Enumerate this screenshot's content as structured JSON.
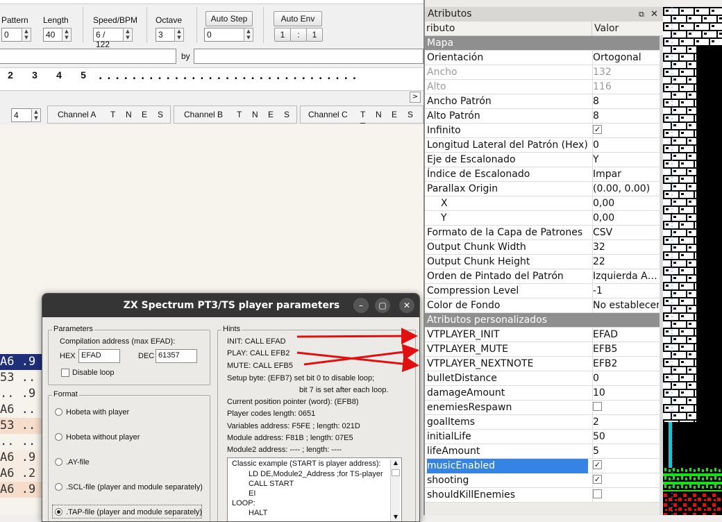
{
  "tracker": {
    "pattern_label": "Pattern",
    "pattern_value": "0",
    "length_label": "Length",
    "length_value": "40",
    "speed_label": "Speed/BPM",
    "speed_value": "6 / 122",
    "octave_label": "Octave",
    "octave_value": "3",
    "autostep_label": "Auto Step",
    "autostep_value": "0",
    "autoenv_label": "Auto Env",
    "autoenv_a": "1",
    "autoenv_sep": ":",
    "autoenv_b": "1",
    "by_label": "by",
    "positions": [
      "2",
      "3",
      "4",
      "5"
    ],
    "positions_rest": ". . . . . . . . . . . . . . . . . . . . . . . . . . . . . . .",
    "scroll_right": ">",
    "channel_spin_value": "4",
    "channels": [
      {
        "name": "Channel A",
        "flags": [
          "T",
          "N",
          "E",
          "S"
        ]
      },
      {
        "name": "Channel B",
        "flags": [
          "T",
          "N",
          "E",
          "S"
        ]
      },
      {
        "name": "Channel C",
        "flags": [
          "T",
          "N",
          "E",
          "S"
        ]
      }
    ],
    "rows": [
      {
        "a": "A6",
        "b": ".9"
      },
      {
        "a": "53",
        "b": ".."
      },
      {
        "a": "..",
        "b": ".9"
      },
      {
        "a": "A6",
        "b": ".."
      },
      {
        "a": "53",
        "b": ".."
      },
      {
        "a": "..",
        "b": ".."
      },
      {
        "a": "A6",
        "b": ".9"
      },
      {
        "a": "A6",
        "b": ".2"
      },
      {
        "a": "A6",
        "b": ".9"
      }
    ]
  },
  "dialog": {
    "title": "ZX Spectrum PT3/TS player parameters",
    "parameters_label": "Parameters",
    "compilation_label": "Compilation address (max    EFAD):",
    "hex_label": "HEX",
    "hex_value": "EFAD",
    "dec_label": "DEC",
    "dec_value": "61357",
    "disable_loop": "Disable loop",
    "format_label": "Format",
    "formats": [
      "Hobeta with player",
      "Hobeta without player",
      ".AY-file",
      ".SCL-file (player and module separately)",
      ".TAP-file (player and module separately)"
    ],
    "hints_label": "Hints",
    "hints": [
      "INIT: CALL  EFAD",
      "PLAY: CALL   EFB2",
      "MUTE: CALL    EFB5",
      "Setup byte:  (EFB7)   set bit 0 to disable loop;",
      "bit 7 is set after each loop.",
      "Current position pointer (word):   (EFB8)",
      "Player codes length:     0651",
      "Variables address:  F5FE  ; length:  021D",
      "Module address:     F81B  ; length:  07E5",
      "Module2 address:    ----      ; length:  ----"
    ],
    "code": [
      "Classic example (START is player address):",
      "LD DE,Module2_Address ;for TS-player",
      "CALL START",
      "EI",
      "LOOP:",
      "HALT"
    ]
  },
  "props": {
    "title": "Atributos",
    "col_name": "ributo",
    "col_value": "Valor",
    "rows": [
      {
        "k": "Mapa",
        "v": "",
        "type": "group"
      },
      {
        "k": "Orientación",
        "v": "Ortogonal"
      },
      {
        "k": "Ancho",
        "v": "132",
        "type": "dis"
      },
      {
        "k": "Alto",
        "v": "116",
        "type": "dis"
      },
      {
        "k": "Ancho Patrón",
        "v": "8"
      },
      {
        "k": "Alto Patrón",
        "v": "8"
      },
      {
        "k": "Infinito",
        "v": "",
        "check": true
      },
      {
        "k": "Longitud Lateral del Patrón (Hex)",
        "v": "0"
      },
      {
        "k": "Eje de Escalonado",
        "v": "Y"
      },
      {
        "k": "Índice de Escalonado",
        "v": "Impar"
      },
      {
        "k": "Parallax Origin",
        "v": "(0.00, 0.00)"
      },
      {
        "k": "X",
        "v": "0,00",
        "indent": true
      },
      {
        "k": "Y",
        "v": "0,00",
        "indent": true
      },
      {
        "k": "Formato de la Capa de Patrones",
        "v": "CSV"
      },
      {
        "k": "Output Chunk Width",
        "v": "32"
      },
      {
        "k": "Output Chunk Height",
        "v": "22"
      },
      {
        "k": "Orden de Pintado del Patrón",
        "v": "Izquierda A…"
      },
      {
        "k": "Compression Level",
        "v": "-1"
      },
      {
        "k": "Color de Fondo",
        "v": "No establecer"
      },
      {
        "k": "Atributos personalizados",
        "v": "",
        "type": "group"
      },
      {
        "k": "VTPLAYER_INIT",
        "v": "EFAD"
      },
      {
        "k": "VTPLAYER_MUTE",
        "v": "EFB5"
      },
      {
        "k": "VTPLAYER_NEXTNOTE",
        "v": "EFB2"
      },
      {
        "k": "bulletDistance",
        "v": "0"
      },
      {
        "k": "damageAmount",
        "v": "10"
      },
      {
        "k": "enemiesRespawn",
        "v": "",
        "check": false
      },
      {
        "k": "goalItems",
        "v": "2"
      },
      {
        "k": "initialLife",
        "v": "50"
      },
      {
        "k": "lifeAmount",
        "v": "5"
      },
      {
        "k": "musicEnabled",
        "v": "",
        "check": true,
        "type": "sel"
      },
      {
        "k": "shooting",
        "v": "",
        "check": true
      },
      {
        "k": "shouldKillEnemies",
        "v": "",
        "check": false
      }
    ]
  },
  "colors": {
    "selection": "#3584e4",
    "arrow": "#e01010",
    "group_row": "#8f8f8f"
  }
}
